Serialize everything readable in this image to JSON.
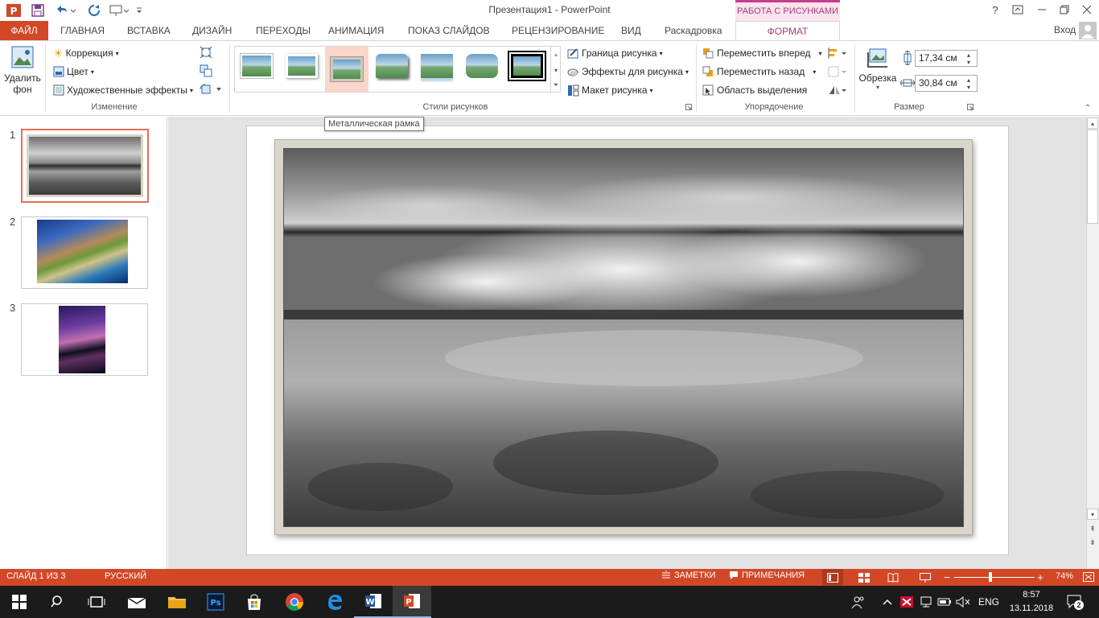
{
  "window": {
    "title": "Презентация1 - PowerPoint",
    "contextual_header": "РАБОТА С РИСУНКАМИ",
    "help": "?",
    "sign_in": "Вход"
  },
  "tabs": [
    "ФАЙЛ",
    "ГЛАВНАЯ",
    "ВСТАВКА",
    "ДИЗАЙН",
    "ПЕРЕХОДЫ",
    "АНИМАЦИЯ",
    "ПОКАЗ СЛАЙДОВ",
    "РЕЦЕНЗИРОВАНИЕ",
    "ВИД",
    "Раскадровка",
    "ФОРМАТ"
  ],
  "ribbon": {
    "remove_bg": {
      "line1": "Удалить",
      "line2": "фон"
    },
    "adjust": {
      "correction": "Коррекция",
      "color": "Цвет",
      "artistic": "Художественные эффекты",
      "label": "Изменение"
    },
    "styles": {
      "label": "Стили рисунков",
      "count": 7,
      "selected_index": 2
    },
    "picture": {
      "border": "Граница рисунка",
      "effects": "Эффекты для рисунка",
      "layout": "Макет рисунка"
    },
    "arrange": {
      "forward": "Переместить вперед",
      "backward": "Переместить назад",
      "selection": "Область выделения",
      "label": "Упорядочение"
    },
    "size": {
      "crop": "Обрезка",
      "height": "17,34 см",
      "width": "30,84 см",
      "label": "Размер"
    }
  },
  "tooltip": "Металлическая рамка",
  "slides": [
    {
      "num": "1",
      "selected": true
    },
    {
      "num": "2",
      "selected": false
    },
    {
      "num": "3",
      "selected": false
    }
  ],
  "status": {
    "slide": "СЛАЙД 1 ИЗ 3",
    "lang": "РУССКИЙ",
    "notes": "ЗАМЕТКИ",
    "comments": "ПРИМЕЧАНИЯ",
    "zoom": "74%",
    "zoom_fraction": 0.45
  },
  "taskbar": {
    "lang": "ENG",
    "time": "8:57",
    "date": "13.11.2018",
    "notifications": "2"
  },
  "colors": {
    "accent": "#d24726",
    "context": "#a73b7a"
  }
}
